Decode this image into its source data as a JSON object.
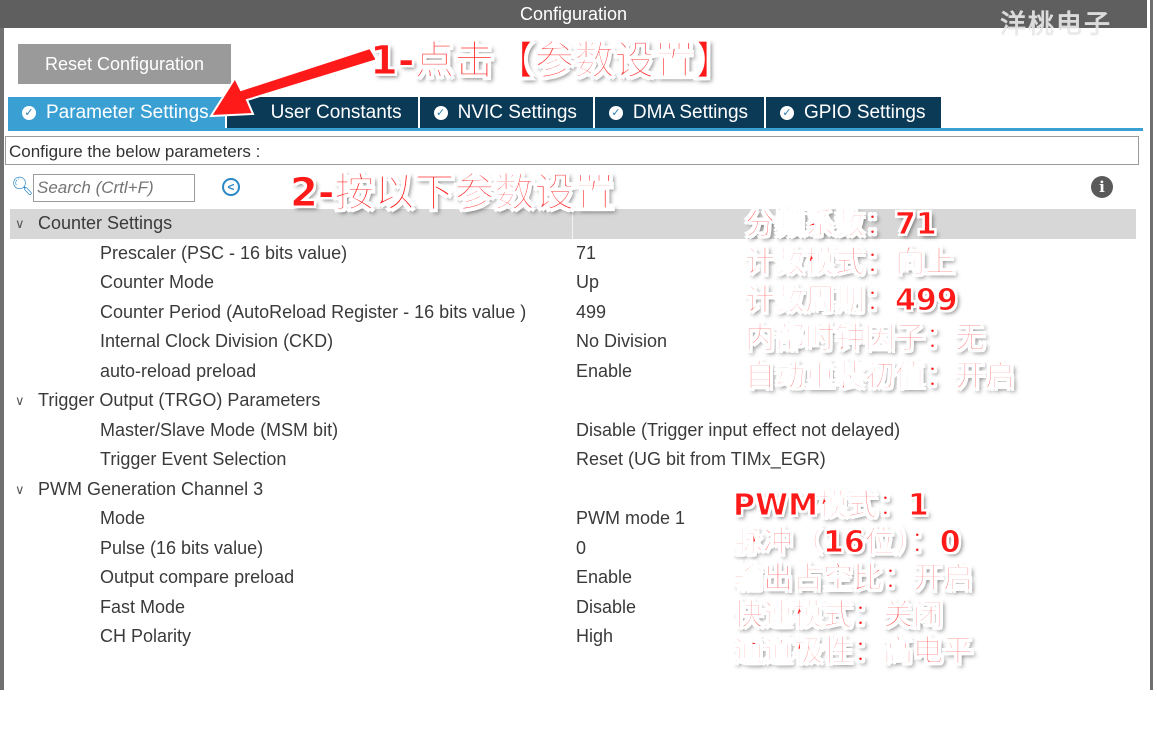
{
  "window": {
    "title": "Configuration",
    "watermark": "洋桃电子"
  },
  "toolbar": {
    "reset_label": "Reset Configuration"
  },
  "tabs": [
    {
      "label": "Parameter Settings",
      "active": true
    },
    {
      "label": "User Constants",
      "active": false
    },
    {
      "label": "NVIC Settings",
      "active": false
    },
    {
      "label": "DMA Settings",
      "active": false
    },
    {
      "label": "GPIO Settings",
      "active": false
    }
  ],
  "description": "Configure the below parameters :",
  "search": {
    "placeholder": "Search (Crtl+F)"
  },
  "groups": {
    "counter": {
      "title": "Counter Settings",
      "params": [
        {
          "name": "Prescaler (PSC - 16 bits value)",
          "value": "71"
        },
        {
          "name": "Counter Mode",
          "value": "Up"
        },
        {
          "name": "Counter Period (AutoReload Register - 16 bits value )",
          "value": "499"
        },
        {
          "name": "Internal Clock Division (CKD)",
          "value": "No Division"
        },
        {
          "name": "auto-reload preload",
          "value": "Enable"
        }
      ]
    },
    "trigger": {
      "title": "Trigger Output (TRGO) Parameters",
      "params": [
        {
          "name": "Master/Slave Mode (MSM bit)",
          "value": "Disable (Trigger input effect not delayed)"
        },
        {
          "name": "Trigger Event Selection",
          "value": "Reset (UG bit from TIMx_EGR)"
        }
      ]
    },
    "pwm": {
      "title": "PWM Generation Channel 3",
      "params": [
        {
          "name": "Mode",
          "value": "PWM mode 1"
        },
        {
          "name": "Pulse (16 bits value)",
          "value": "0"
        },
        {
          "name": "Output compare preload",
          "value": "Enable"
        },
        {
          "name": "Fast Mode",
          "value": "Disable"
        },
        {
          "name": "CH Polarity",
          "value": "High"
        }
      ]
    }
  },
  "annotations": {
    "step1": "1-点击【参数设置】",
    "step2": "2-按以下参数设置",
    "counter_notes": [
      "分频系数：71",
      "计数模式：向上",
      "计数周期：499",
      "内部时钟因子：无",
      "自动重装初值：开启"
    ],
    "pwm_notes": [
      "PWM模式：1",
      "脉冲（16位）：0",
      "输出占空比：开启",
      "快速模式：关闭",
      "通道极性：高电平"
    ]
  },
  "colors": {
    "tab_active": "#3aa0d4",
    "tab_inactive": "#0b3a57",
    "annotation": "#ff1a1a"
  },
  "icons": [
    "check-circle-icon",
    "search-icon",
    "navigate-back-icon",
    "info-icon",
    "chevron-down-icon",
    "arrow-pointer-icon"
  ]
}
